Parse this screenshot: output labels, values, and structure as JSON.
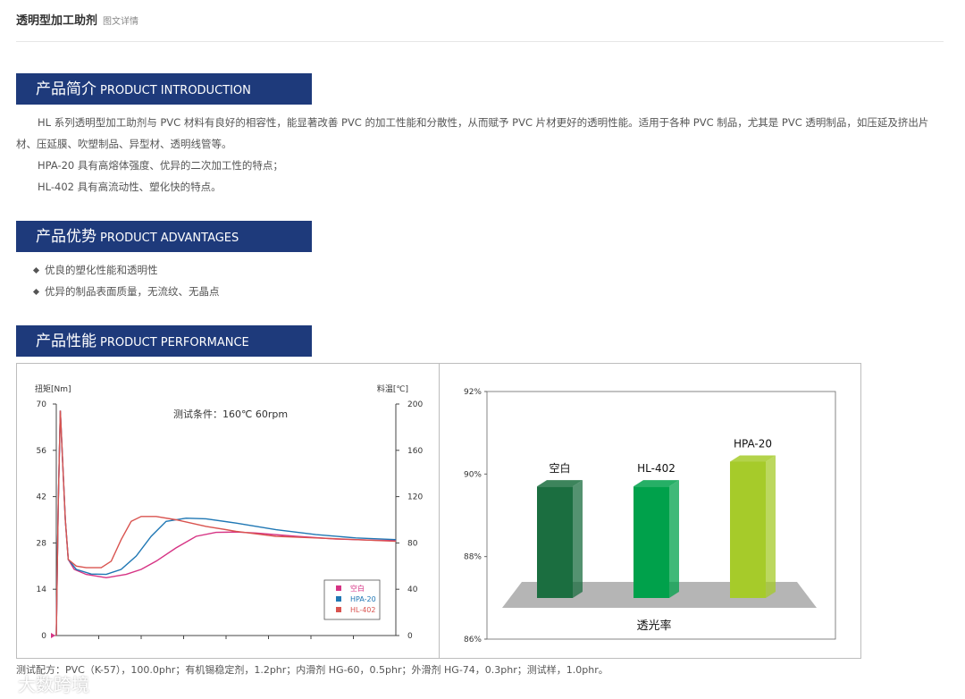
{
  "header": {
    "title": "透明型加工助剂",
    "subtitle": "图文详情"
  },
  "sections": {
    "intro": {
      "cn": "产品简介",
      "en": "PRODUCT INTRODUCTION"
    },
    "advantages": {
      "cn": "产品优势",
      "en": "PRODUCT ADVANTAGES"
    },
    "performance": {
      "cn": "产品性能",
      "en": "PRODUCT PERFORMANCE"
    }
  },
  "intro_paragraphs": [
    "HL 系列透明型加工助剂与 PVC 材料有良好的相容性，能显著改善 PVC 的加工性能和分散性，从而赋予 PVC 片材更好的透明性能。适用于各种 PVC 制品，尤其是 PVC 透明制品，如压延及挤出片材、压延膜、吹塑制品、异型材、透明线管等。",
    "HPA-20 具有高熔体强度、优异的二次加工性的特点；",
    "HL-402 具有高流动性、塑化快的特点。"
  ],
  "advantages": [
    "优良的塑化性能和透明性",
    "优异的制品表面质量，无流纹、无晶点"
  ],
  "chart_data": [
    {
      "type": "line",
      "annotation": "测试条件：160℃ 60rpm",
      "ylabel": "扭矩[Nm]",
      "y2label": "料温[℃]",
      "ylim": [
        0,
        70
      ],
      "y2lim": [
        0,
        200
      ],
      "yticks": [
        "70",
        "56",
        "42",
        "28",
        "14",
        "0"
      ],
      "y2ticks": [
        "200",
        "160",
        "120",
        "80",
        "40",
        "0"
      ],
      "legend_position": "bottom-right",
      "colors": {
        "blank": "#d63384",
        "hpa20": "#1f77b4",
        "hl402": "#d9534f"
      },
      "series": [
        {
          "name": "空白",
          "points": [
            [
              0,
              0
            ],
            [
              0.2,
              40
            ],
            [
              0.4,
              68
            ],
            [
              0.6,
              55
            ],
            [
              0.9,
              35
            ],
            [
              1.2,
              23
            ],
            [
              1.8,
              20
            ],
            [
              3,
              18.5
            ],
            [
              5,
              17.5
            ],
            [
              7,
              18.5
            ],
            [
              8.5,
              20
            ],
            [
              10,
              22.5
            ],
            [
              12,
              26.5
            ],
            [
              14,
              30
            ],
            [
              16,
              31.2
            ],
            [
              18,
              31.3
            ],
            [
              20,
              31
            ],
            [
              24,
              30
            ],
            [
              28,
              29.2
            ],
            [
              32,
              28.8
            ],
            [
              34,
              28.8
            ]
          ]
        },
        {
          "name": "HPA-20",
          "points": [
            [
              0,
              0
            ],
            [
              0.2,
              40
            ],
            [
              0.4,
              68
            ],
            [
              0.6,
              55
            ],
            [
              0.9,
              35
            ],
            [
              1.2,
              23
            ],
            [
              2,
              20
            ],
            [
              3.5,
              18.6
            ],
            [
              5,
              18.5
            ],
            [
              6.5,
              20
            ],
            [
              8,
              24
            ],
            [
              9.5,
              30
            ],
            [
              11,
              34.5
            ],
            [
              13,
              35.5
            ],
            [
              15,
              35.3
            ],
            [
              18,
              34
            ],
            [
              22,
              32
            ],
            [
              26,
              30.5
            ],
            [
              30,
              29.5
            ],
            [
              34,
              29
            ]
          ]
        },
        {
          "name": "HL-402",
          "points": [
            [
              0,
              0
            ],
            [
              0.2,
              40
            ],
            [
              0.4,
              68
            ],
            [
              0.6,
              55
            ],
            [
              0.9,
              35
            ],
            [
              1.2,
              23
            ],
            [
              2,
              21
            ],
            [
              3,
              20.5
            ],
            [
              4.5,
              20.5
            ],
            [
              5.5,
              22.5
            ],
            [
              6.5,
              29
            ],
            [
              7.5,
              34.5
            ],
            [
              8.5,
              36
            ],
            [
              10,
              36
            ],
            [
              12,
              35
            ],
            [
              15,
              33
            ],
            [
              18,
              31.5
            ],
            [
              22,
              30
            ],
            [
              26,
              29.5
            ],
            [
              30,
              29
            ],
            [
              34,
              28.5
            ]
          ]
        }
      ]
    },
    {
      "type": "bar",
      "xlabel": "透光率",
      "ylim": [
        86,
        92
      ],
      "yticks": [
        "92%",
        "90%",
        "88%",
        "86%"
      ],
      "categories": [
        "空白",
        "HL-402",
        "HPA-20"
      ],
      "values": [
        89.7,
        89.7,
        90.3
      ],
      "colors": [
        "#1b6e40",
        "#00a14b",
        "#a6cb2a"
      ]
    }
  ],
  "footnote": "测试配方：PVC（K-57），100.0phr；有机锡稳定剂，1.2phr；内滑剂 HG-60，0.5phr；外滑剂 HG-74，0.3phr；测试样，1.0phr。",
  "watermark": "大数跨境"
}
